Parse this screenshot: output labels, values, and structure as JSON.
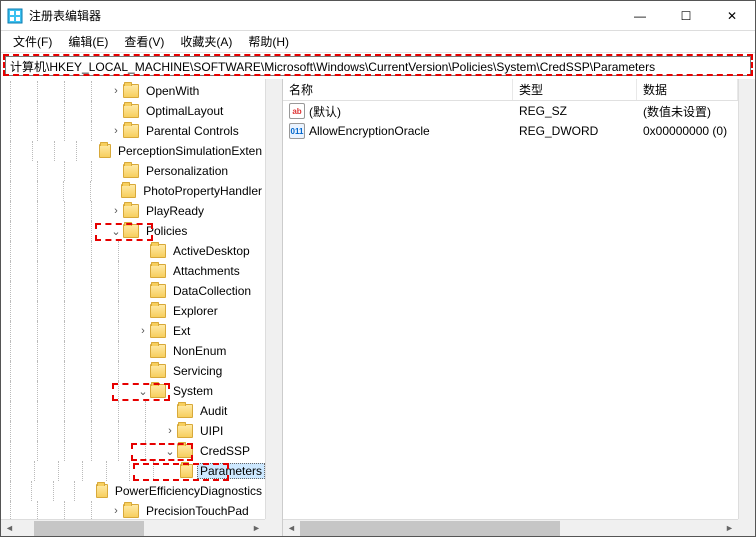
{
  "window": {
    "title": "注册表编辑器"
  },
  "menu": {
    "file": "文件(F)",
    "edit": "编辑(E)",
    "view": "查看(V)",
    "fav": "收藏夹(A)",
    "help": "帮助(H)"
  },
  "address": "计算机\\HKEY_LOCAL_MACHINE\\SOFTWARE\\Microsoft\\Windows\\CurrentVersion\\Policies\\System\\CredSSP\\Parameters",
  "tree": {
    "n0": "OpenWith",
    "n1": "OptimalLayout",
    "n2": "Parental Controls",
    "n3": "PerceptionSimulationExten",
    "n4": "Personalization",
    "n5": "PhotoPropertyHandler",
    "n6": "PlayReady",
    "n7": "Policies",
    "n8": "ActiveDesktop",
    "n9": "Attachments",
    "n10": "DataCollection",
    "n11": "Explorer",
    "n12": "Ext",
    "n13": "NonEnum",
    "n14": "Servicing",
    "n15": "System",
    "n16": "Audit",
    "n17": "UIPI",
    "n18": "CredSSP",
    "n19": "Parameters",
    "n20": "PowerEfficiencyDiagnostics",
    "n21": "PrecisionTouchPad"
  },
  "list": {
    "col_name": "名称",
    "col_type": "类型",
    "col_data": "数据",
    "r0": {
      "name": "(默认)",
      "type": "REG_SZ",
      "data": "(数值未设置)"
    },
    "r1": {
      "name": "AllowEncryptionOracle",
      "type": "REG_DWORD",
      "data": "0x00000000 (0)"
    }
  },
  "winbtn": {
    "min": "—",
    "max": "☐",
    "close": "✕"
  }
}
